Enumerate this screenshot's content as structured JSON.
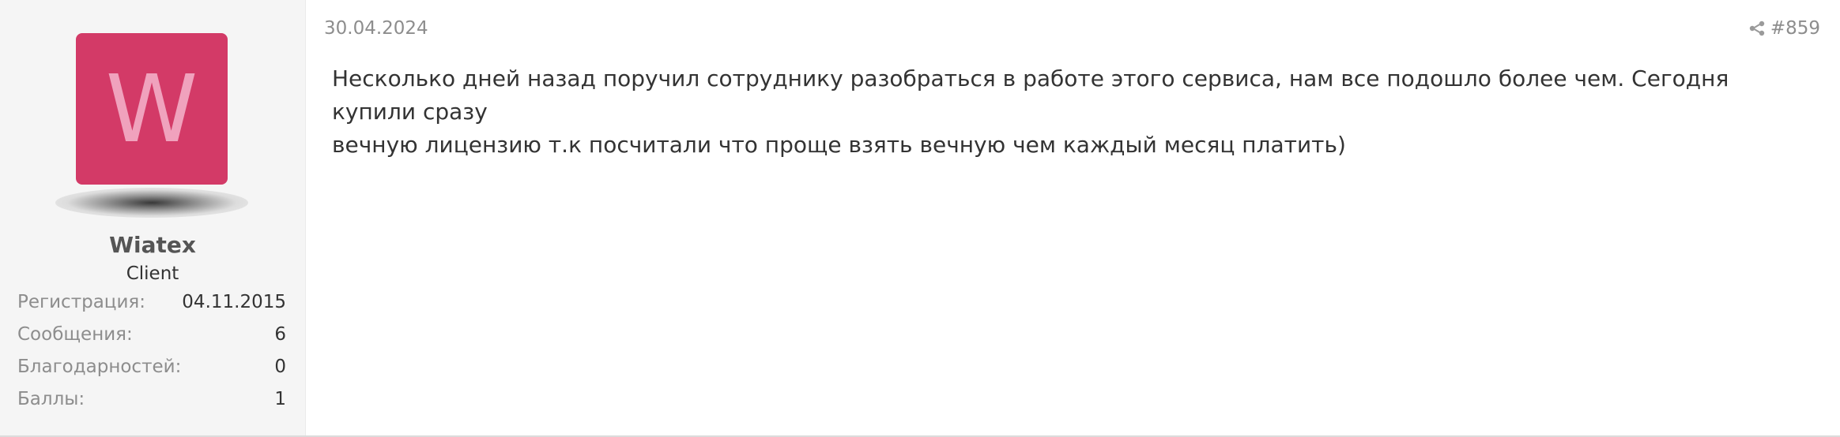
{
  "post": {
    "date": "30.04.2024",
    "number": "#859",
    "message": "Несколько дней назад поручил сотруднику разобраться в работе этого сервиса, нам все подошло более чем. Сегодня купили сразу\nвечную лицензию т.к посчитали что проще взять вечную чем каждый месяц платить)"
  },
  "user": {
    "avatar_letter": "W",
    "avatar_color": "#d33a67",
    "name": "Wiatex",
    "role": "Client",
    "stats": [
      {
        "label": "Регистрация:",
        "value": "04.11.2015"
      },
      {
        "label": "Сообщения:",
        "value": "6"
      },
      {
        "label": "Благодарностей:",
        "value": "0"
      },
      {
        "label": "Баллы:",
        "value": "1"
      }
    ]
  },
  "icons": {
    "share": "share-icon"
  }
}
